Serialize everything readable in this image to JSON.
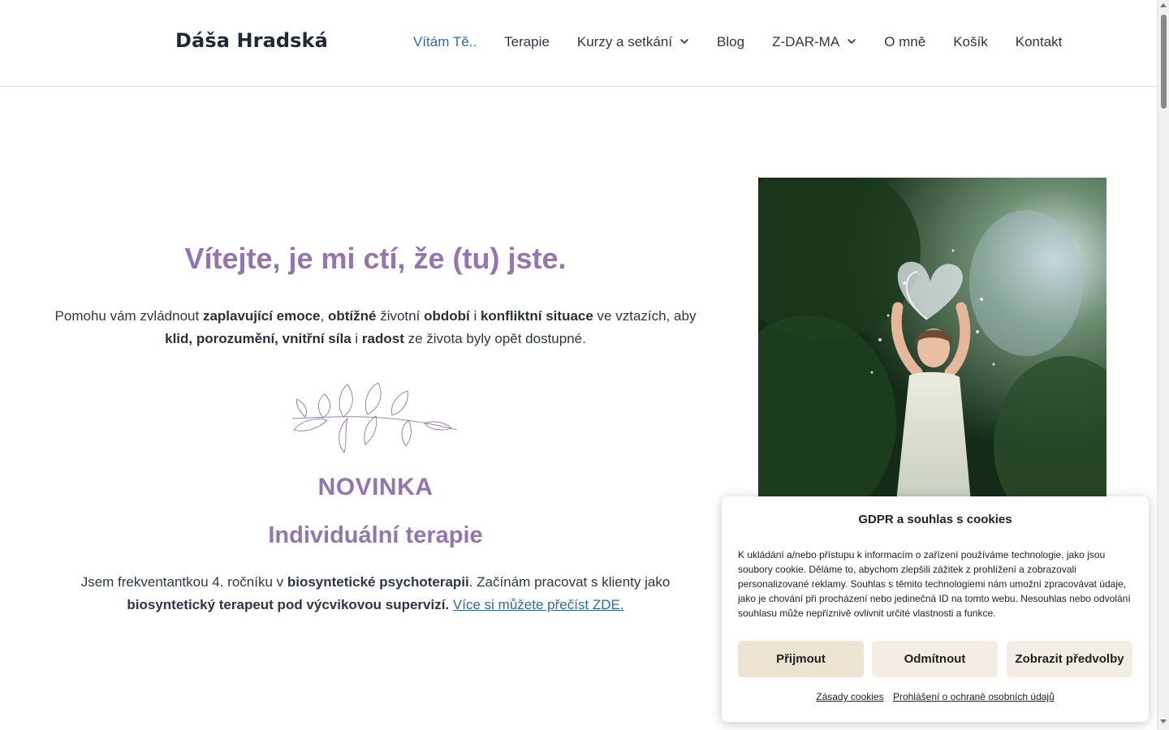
{
  "header": {
    "logo": "Dáša Hradská",
    "nav": [
      {
        "label": "Vítám Tě..",
        "active": true
      },
      {
        "label": "Terapie"
      },
      {
        "label": "Kurzy a setkání",
        "dropdown": true
      },
      {
        "label": "Blog"
      },
      {
        "label": "Z-DAR-MA",
        "dropdown": true
      },
      {
        "label": "O mně"
      },
      {
        "label": "Košík"
      },
      {
        "label": "Kontakt"
      }
    ]
  },
  "hero": {
    "title": "Vítejte, je mi ctí, že (tu) jste.",
    "text_parts": {
      "p1": "Pomohu vám zvládnout ",
      "b1": "zaplavující emoce",
      "p2": ", ",
      "b2": "obtížné",
      "p3": " životní ",
      "b3": "období",
      "p4": " i ",
      "b4": "konfliktní situace",
      "p5": " ve vztazích, aby ",
      "b5": "klid, porozumění, vnitřní síla",
      "p6": " i ",
      "b6": "radost",
      "p7": " ze života byly opět dostupné."
    }
  },
  "news": {
    "badge": "NOVINKA",
    "subtitle": "Individuální terapie",
    "text_parts": {
      "p1": "Jsem frekventantkou 4. ročníku v ",
      "b1": "biosyntetické psychoterapii",
      "p2": ". Začínám pracovat s klienty jako ",
      "b2": "biosyntetický terapeut pod výcvikovou supervizí.",
      "p3": " ",
      "link": "Více si můžete přečíst ZDE."
    }
  },
  "cookie": {
    "title": "GDPR a souhlas s cookies",
    "text": "K ukládání a/nebo přístupu k informacím o zařízení používáme technologie, jako jsou soubory cookie. Děláme to, abychom zlepšili zážitek z prohlížení a zobrazovali personalizované reklamy. Souhlas s těmito technologiemi nám umožní zpracovávat údaje, jako je chování při procházení nebo jedinečná ID na tomto webu. Nesouhlas nebo odvolání souhlasu může nepříznivě ovlivnit určité vlastnosti a funkce.",
    "accept": "Přijmout",
    "deny": "Odmítnout",
    "prefs": "Zobrazit předvolby",
    "link_cookies": "Zásady cookies",
    "link_privacy": "Prohlášení o ochraně osobních údajů"
  },
  "colors": {
    "accent_purple": "#9276ae",
    "link_blue": "#2c6aa9",
    "button_beige": "#ede3d3"
  },
  "icons": {
    "dropdown": "chevron-down-icon",
    "decor": "leaf-branch-icon"
  }
}
